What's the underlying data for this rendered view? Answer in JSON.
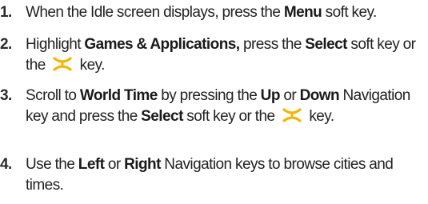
{
  "steps": [
    {
      "num": "1.",
      "a": "When the Idle screen displays, press the ",
      "b1": "Menu",
      "c": " soft key."
    },
    {
      "num": "2.",
      "a": "Highlight ",
      "b1": "Games & Applications,",
      "c": " press the ",
      "b2": "Select",
      "d": " soft key or the ",
      "e": " key."
    },
    {
      "num": "3.",
      "a": "Scroll to ",
      "b1": "World Time",
      "c": " by pressing the ",
      "b2": "Up",
      "d": " or ",
      "b3": "Down",
      "e": " Navigation key and press the ",
      "b4": "Select",
      "f": " soft key or the ",
      "g": " key."
    },
    {
      "num": "4.",
      "a": "Use the ",
      "b1": "Left",
      "c": " or ",
      "b2": "Right",
      "d": " Navigation keys to browse cities and times."
    }
  ],
  "icons": {
    "ok_key": "ok-key-icon",
    "ok_key_color": "#f5b400"
  }
}
